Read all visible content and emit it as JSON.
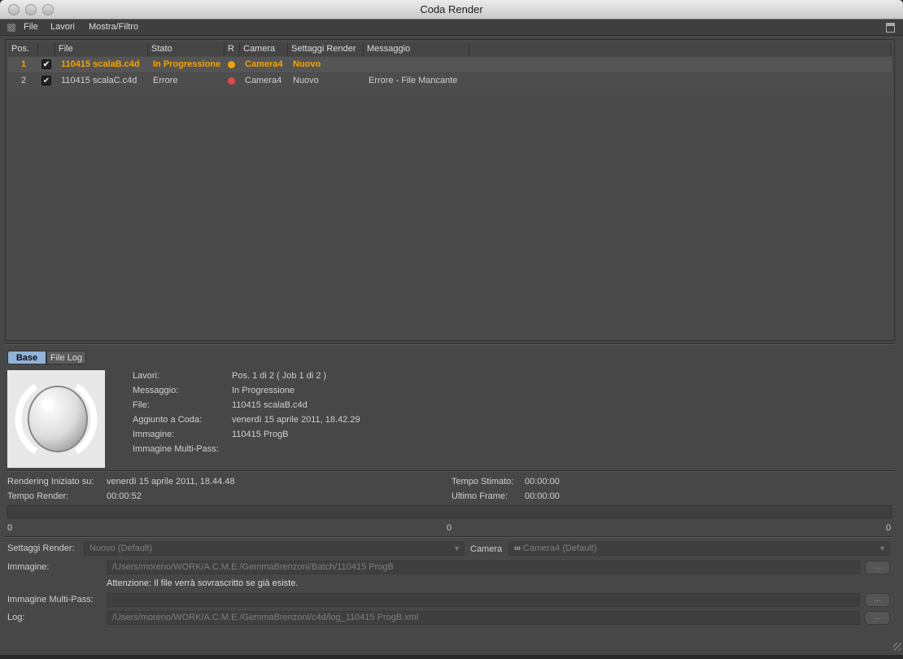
{
  "window": {
    "title": "Coda Render"
  },
  "menu": [
    "File",
    "Lavori",
    "Mostra/Filtro"
  ],
  "table": {
    "columns": [
      "Pos.",
      "",
      "File",
      "Stato",
      "R",
      "Camera",
      "Settaggi Render",
      "Messaggio"
    ],
    "rows": [
      {
        "pos": "1",
        "checked": "✔",
        "file": "110415 scalaB.c4d",
        "stato": "In Progressione",
        "r_color": "#f5a300",
        "camera": "Camera4",
        "settaggi": "Nuovo",
        "messaggio": "",
        "active": true
      },
      {
        "pos": "2",
        "checked": "✔",
        "file": "110415 scalaC.c4d",
        "stato": "Errore",
        "r_color": "#e04848",
        "camera": "Camera4",
        "settaggi": "Nuovo",
        "messaggio": "Errore - File Mancante",
        "active": false
      }
    ]
  },
  "tabs": {
    "base": "Base",
    "filelog": "File Log",
    "active": "Base"
  },
  "info": {
    "labels": [
      "Lavori:",
      "Messaggio:",
      "File:",
      "Aggiunto a Coda:",
      "Immagine:",
      "Immagine Multi-Pass:"
    ],
    "values": [
      "Pos. 1 di 2 ( Job 1 di 2 )",
      "In Progressione",
      "110415 scalaB.c4d",
      "venerdì 15 aprile 2011, 18.42.29",
      "110415 ProgB",
      ""
    ]
  },
  "status": {
    "started_label": "Rendering Iniziato su:",
    "started_value": "venerdì 15 aprile 2011, 18.44.48",
    "render_time_label": "Tempo Render:",
    "render_time_value": "00:00:52",
    "estimated_label": "Tempo Stimato:",
    "estimated_value": "00:00:00",
    "last_frame_label": "Ultimo Frame:",
    "last_frame_value": "00:00:00",
    "progress": 0,
    "progress_labels": [
      "0",
      "0",
      "0"
    ]
  },
  "settings": {
    "render_label": "Settaggi Render:",
    "render_value": "Nuovo (Default)",
    "camera_label": "Camera",
    "camera_value": "Camera4 (Default)",
    "image_label": "Immagine:",
    "image_value": "/Users/moreno/WORK/A.C.M.E./GemmaBrenzoni/Batch/110415 ProgB",
    "warning": "Attenzione: Il file verrà sovrascritto se già esiste.",
    "multipass_label": "Immagine Multi-Pass:",
    "multipass_value": "",
    "log_label": "Log:",
    "log_value": "/Users/moreno/WORK/A.C.M.E./GemmaBrenzoni/c4d/log_110415 ProgB.xml",
    "browse": "..."
  },
  "colors": {
    "accent": "#f5a300",
    "error": "#e04848",
    "tab_active": "#8fb3d9"
  }
}
